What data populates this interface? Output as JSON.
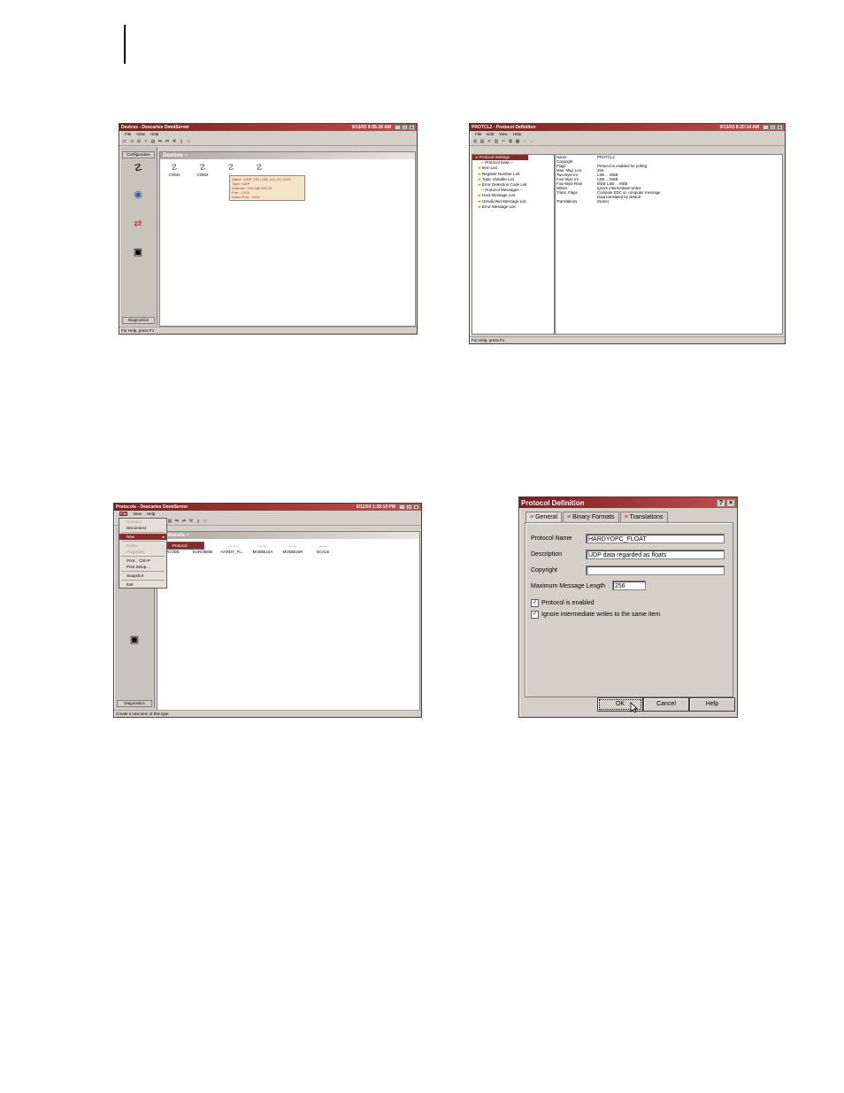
{
  "devices_window": {
    "title": "Devices - Descartes OmniServer",
    "clock": "9/15/03 9:05:26 AM",
    "menu": [
      "File",
      "View",
      "Help"
    ],
    "sidebar_tabs": {
      "top": "Configuration",
      "bottom": "Diagnostics"
    },
    "header": "Devices --",
    "devices": [
      "COM1",
      "COM2",
      "",
      ""
    ],
    "tooltip": [
      "Name : UDP_192_168_110_37_1024",
      "Type : UDP",
      "Address : 192.168.110.37",
      "Port : 1024",
      "Listen Port : 1024"
    ],
    "status": "For Help, press F1"
  },
  "protocol_window": {
    "title": "PROTCL2 - Protocol Definition",
    "clock": "9/15/03 8:20:14 AM",
    "menu": [
      "File",
      "Edit",
      "View",
      "Help"
    ],
    "tree": [
      {
        "label": "Protocol Settings",
        "folder": true,
        "selected": true
      },
      {
        "label": "-- Protocol Data --",
        "folder": false,
        "selected": false
      },
      {
        "label": "Item List",
        "folder": true,
        "selected": false
      },
      {
        "label": "Register Number List",
        "folder": true,
        "selected": false
      },
      {
        "label": "Topic Variable List",
        "folder": true,
        "selected": false
      },
      {
        "label": "Error Detection Code List",
        "folder": true,
        "selected": false
      },
      {
        "label": "-- Protocol Messages --",
        "folder": false,
        "selected": false
      },
      {
        "label": "Host Message List",
        "folder": true,
        "selected": false
      },
      {
        "label": "Unsolicited Message List",
        "folder": true,
        "selected": false
      },
      {
        "label": "Error Message List",
        "folder": true,
        "selected": false
      }
    ],
    "props": [
      {
        "k": "Name",
        "v": "PROTCL2"
      },
      {
        "k": "Copyright",
        "v": ""
      },
      {
        "k": "Flags",
        "v": "Protocol is enabled for polling"
      },
      {
        "k": "Max. Msg. Len.",
        "v": "256"
      },
      {
        "k": "Two-Byte Int",
        "v": "LSB ... MSB"
      },
      {
        "k": "Four-Byte Int",
        "v": "LSB ... MSB"
      },
      {
        "k": "Four-Byte Real",
        "v": "IEEE LSB ... MSB"
      },
      {
        "k": "Writes",
        "v": "Ignore intermediate writes"
      },
      {
        "k": "Trans. Flags",
        "v": "Compute EDC on computer message"
      },
      {
        "k": "",
        "v": "Data translated by default"
      },
      {
        "k": "Translations",
        "v": "(None)"
      }
    ],
    "status": "For Help, press F1"
  },
  "protocols_window": {
    "title": "Protocols - Descartes OmniServer",
    "clock": "6/12/03 1:35:10 PM",
    "menu": [
      "File",
      "View",
      "Help"
    ],
    "file_menu": [
      {
        "label": "Connect",
        "state": "disabled"
      },
      {
        "label": "Disconnect",
        "state": "normal"
      },
      {
        "label": "sep",
        "state": "sep"
      },
      {
        "label": "New",
        "state": "selected"
      },
      {
        "label": "sep",
        "state": "sep"
      },
      {
        "label": "Delete",
        "state": "disabled"
      },
      {
        "label": "Properties",
        "state": "disabled"
      },
      {
        "label": "sep",
        "state": "sep"
      },
      {
        "label": "Print... Ctrl+P",
        "state": "normal"
      },
      {
        "label": "Print Setup...",
        "state": "normal"
      },
      {
        "label": "sep",
        "state": "sep"
      },
      {
        "label": "Snapshot",
        "state": "normal"
      },
      {
        "label": "sep",
        "state": "sep"
      },
      {
        "label": "Exit",
        "state": "normal"
      }
    ],
    "submenu_item": "Protocol",
    "header": "Protocols --",
    "protocols": [
      "PCODE",
      "EUROBOB",
      "HARDY_FL...",
      "MODBUSA",
      "MODBUSR",
      "SCALE"
    ],
    "sidebar_bottom": "Diagnostics",
    "status": "Create a new item of this type"
  },
  "dialog": {
    "title": "Protocol Definition",
    "tabs": [
      "General",
      "Binary Formats",
      "Translations"
    ],
    "fields": {
      "protocol_name_label": "Protocol Name",
      "protocol_name": "HARDYOPC_FLOAT",
      "description_label": "Description",
      "description": "UDP data regarded as floats",
      "copyright_label": "Copyright",
      "copyright": "",
      "max_len_label": "Maximum Message Length",
      "max_len": "256"
    },
    "checks": [
      {
        "label": "Protocol is enabled",
        "checked": true
      },
      {
        "label": "Ignore intermediate writes to the same item",
        "checked": true
      }
    ],
    "buttons": {
      "ok": "OK",
      "cancel": "Cancel",
      "help": "Help"
    }
  }
}
